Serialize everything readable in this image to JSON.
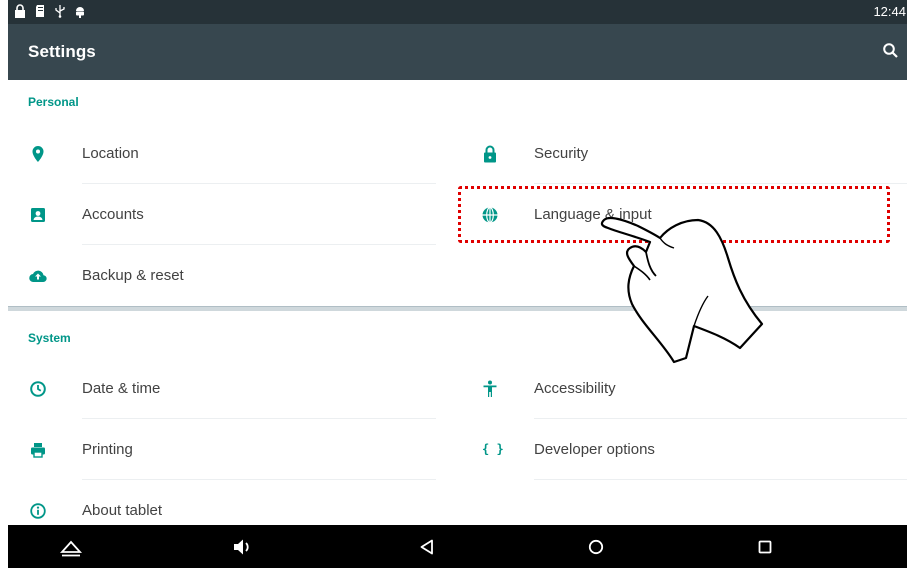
{
  "status_bar": {
    "time": "12:44",
    "icons": [
      "lock-icon",
      "sd-card-icon",
      "usb-icon",
      "android-icon"
    ]
  },
  "app_bar": {
    "title": "Settings",
    "search_icon": "search-icon"
  },
  "sections": {
    "personal": {
      "header": "Personal",
      "items": {
        "location": {
          "label": "Location",
          "icon": "location-pin-icon"
        },
        "security": {
          "label": "Security",
          "icon": "lock-icon"
        },
        "accounts": {
          "label": "Accounts",
          "icon": "account-box-icon"
        },
        "language": {
          "label": "Language & input",
          "icon": "globe-icon"
        },
        "backup": {
          "label": "Backup & reset",
          "icon": "cloud-upload-icon"
        }
      }
    },
    "system": {
      "header": "System",
      "items": {
        "date_time": {
          "label": "Date & time",
          "icon": "clock-icon"
        },
        "accessibility": {
          "label": "Accessibility",
          "icon": "accessibility-icon"
        },
        "printing": {
          "label": "Printing",
          "icon": "printer-icon"
        },
        "developer": {
          "label": "Developer options",
          "icon": "developer-braces-icon",
          "glyph": "{ }"
        },
        "about": {
          "label": "About tablet",
          "icon": "info-icon"
        }
      }
    }
  },
  "nav_bar": {
    "buttons": [
      "hide-icon",
      "volume-icon",
      "back-icon",
      "home-icon",
      "recents-icon"
    ]
  },
  "colors": {
    "accent": "#009688",
    "status_bar": "#263238",
    "app_bar": "#37474f",
    "highlight": "#e00000"
  }
}
